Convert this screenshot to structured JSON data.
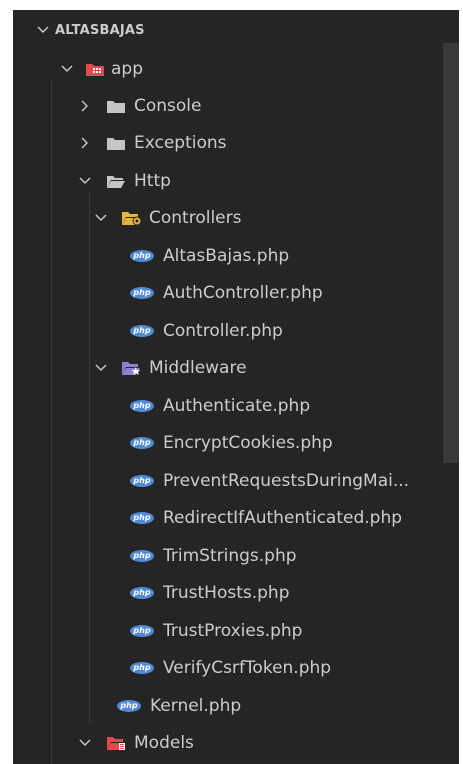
{
  "explorer": {
    "root_label": "ALTASBAJAS",
    "items": [
      {
        "label": "app",
        "type": "folder-app",
        "expanded": true
      },
      {
        "label": "Console",
        "type": "folder",
        "expanded": false
      },
      {
        "label": "Exceptions",
        "type": "folder",
        "expanded": false
      },
      {
        "label": "Http",
        "type": "folder",
        "expanded": true
      },
      {
        "label": "Controllers",
        "type": "folder-controllers",
        "expanded": true
      },
      {
        "label": "AltasBajas.php",
        "type": "php-file"
      },
      {
        "label": "AuthController.php",
        "type": "php-file"
      },
      {
        "label": "Controller.php",
        "type": "php-file"
      },
      {
        "label": "Middleware",
        "type": "folder-middleware",
        "expanded": true
      },
      {
        "label": "Authenticate.php",
        "type": "php-file"
      },
      {
        "label": "EncryptCookies.php",
        "type": "php-file"
      },
      {
        "label": "PreventRequestsDuringMai...",
        "type": "php-file"
      },
      {
        "label": "RedirectIfAuthenticated.php",
        "type": "php-file"
      },
      {
        "label": "TrimStrings.php",
        "type": "php-file"
      },
      {
        "label": "TrustHosts.php",
        "type": "php-file"
      },
      {
        "label": "TrustProxies.php",
        "type": "php-file"
      },
      {
        "label": "VerifyCsrfToken.php",
        "type": "php-file"
      },
      {
        "label": "Kernel.php",
        "type": "php-file"
      },
      {
        "label": "Models",
        "type": "folder-models",
        "expanded": true
      }
    ],
    "php_badge_text": "php",
    "colors": {
      "background": "#252526",
      "text": "#cccccc",
      "folder": "#c5c5c5",
      "app_folder": "#e8474b",
      "controllers_folder": "#e5b73c",
      "middleware_folder": "#8f7fd6",
      "php_badge": "#4f8ad8",
      "models_folder": "#e8474b"
    }
  }
}
